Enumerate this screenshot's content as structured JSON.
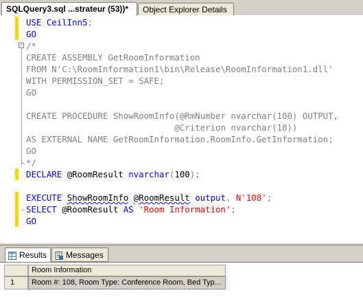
{
  "tabs": [
    {
      "label": "SQLQuery3.sql ...strateur (53))*",
      "active": true
    },
    {
      "label": "Object Explorer Details",
      "active": false
    }
  ],
  "editor": {
    "lines": [
      {
        "tokens": [
          {
            "t": "USE ",
            "c": "kw"
          },
          {
            "t": "CeilInn5",
            "c": "kw"
          },
          {
            "t": ";",
            "c": "gray"
          }
        ]
      },
      {
        "tokens": [
          {
            "t": "GO",
            "c": "kw"
          }
        ]
      },
      {
        "tokens": [
          {
            "t": "/*",
            "c": "gray"
          }
        ]
      },
      {
        "tokens": [
          {
            "t": "CREATE ASSEMBLY GetRoomInformation",
            "c": "gray"
          }
        ]
      },
      {
        "tokens": [
          {
            "t": "FROM N'C:\\RoomInformation1\\bin\\Release\\RoomInformation1.dll'",
            "c": "gray"
          }
        ]
      },
      {
        "tokens": [
          {
            "t": "WITH PERMISSION_SET = SAFE;",
            "c": "gray"
          }
        ]
      },
      {
        "tokens": [
          {
            "t": "GO",
            "c": "gray"
          }
        ]
      },
      {
        "tokens": []
      },
      {
        "tokens": [
          {
            "t": "CREATE PROCEDURE ShowRoomInfo(@RmNumber nvarchar(100) OUTPUT,",
            "c": "gray"
          }
        ]
      },
      {
        "tokens": [
          {
            "t": "                             @Criterion nvarchar(10))",
            "c": "gray"
          }
        ]
      },
      {
        "tokens": [
          {
            "t": "AS EXTERNAL NAME GetRoomInformation.RoomInfo.GetInformation;",
            "c": "gray"
          }
        ]
      },
      {
        "tokens": [
          {
            "t": "GO",
            "c": "gray"
          }
        ]
      },
      {
        "tokens": [
          {
            "t": "*/",
            "c": "gray"
          }
        ]
      },
      {
        "tokens": [
          {
            "t": "DECLARE ",
            "c": "kw"
          },
          {
            "t": "@RoomResult ",
            "c": "blk"
          },
          {
            "t": "nvarchar",
            "c": "kw"
          },
          {
            "t": "(",
            "c": "gray"
          },
          {
            "t": "100",
            "c": "blk"
          },
          {
            "t": ");",
            "c": "gray"
          }
        ]
      },
      {
        "tokens": []
      },
      {
        "tokens": [
          {
            "t": "EXECUTE ",
            "c": "kw"
          },
          {
            "t": "ShowRoomInfo",
            "c": "squiggle"
          },
          {
            "t": " ",
            "c": "blk"
          },
          {
            "t": "@RoomResult",
            "c": "squiggle"
          },
          {
            "t": " ",
            "c": "blk"
          },
          {
            "t": "output",
            "c": "kw"
          },
          {
            "t": ", ",
            "c": "gray"
          },
          {
            "t": "N'108'",
            "c": "red"
          },
          {
            "t": ";",
            "c": "gray"
          }
        ]
      },
      {
        "tokens": [
          {
            "t": "SELECT ",
            "c": "kw"
          },
          {
            "t": "@RoomResult ",
            "c": "blk"
          },
          {
            "t": "AS ",
            "c": "kw"
          },
          {
            "t": "'Room Information'",
            "c": "red"
          },
          {
            "t": ";",
            "c": "gray"
          }
        ]
      },
      {
        "tokens": [
          {
            "t": "GO",
            "c": "kw"
          }
        ]
      }
    ]
  },
  "results_tabs": [
    {
      "label": "Results",
      "icon": "grid-icon",
      "active": true
    },
    {
      "label": "Messages",
      "icon": "messages-icon",
      "active": false
    }
  ],
  "results_grid": {
    "columns": [
      "Room Information"
    ],
    "rows": [
      {
        "num": "1",
        "cells": [
          "Room #: 108, Room Type: Conference Room, Bed Typ..."
        ]
      }
    ]
  }
}
